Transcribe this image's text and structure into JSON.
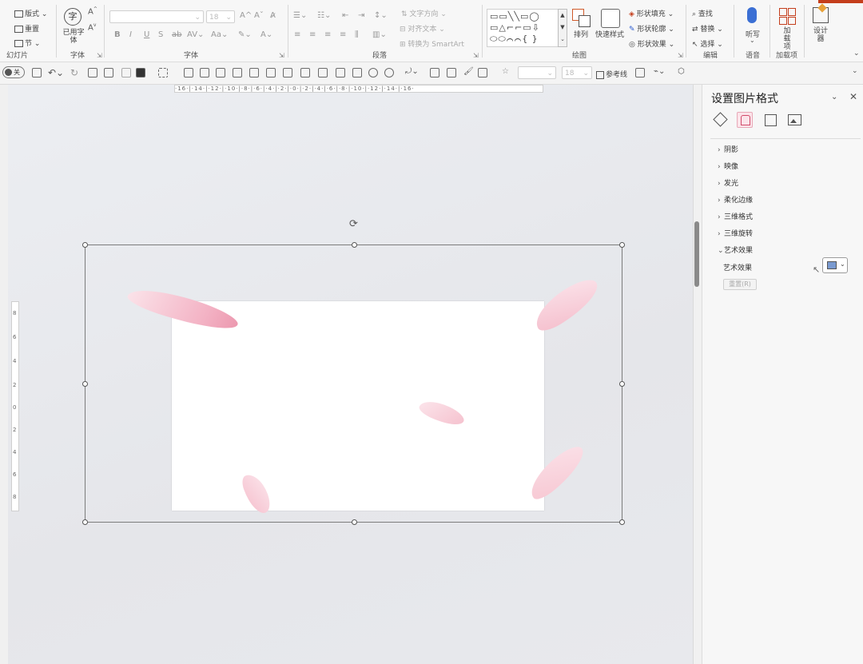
{
  "ribbon": {
    "slides_group": {
      "label": "幻灯片",
      "layout": "版式",
      "reset": "重置",
      "section": "节"
    },
    "font_group": {
      "label": "字体",
      "font_placeholder": "",
      "size_placeholder": "18"
    },
    "used_fonts": {
      "label": "已用字体"
    },
    "paragraph_group": {
      "label": "段落",
      "text_direction": "文字方向",
      "align_text": "对齐文本",
      "convert_smartart": "转换为 SmartArt"
    },
    "drawing_group": {
      "label": "绘图",
      "arrange": "排列",
      "quick_styles": "快速样式",
      "shape_fill": "形状填充",
      "shape_outline": "形状轮廓",
      "shape_effects": "形状效果"
    },
    "editing_group": {
      "label": "编辑",
      "find": "查找",
      "replace": "替换",
      "select": "选择"
    },
    "voice_group": {
      "label": "语音",
      "dictate": "听写"
    },
    "addins_group": {
      "label": "加载项",
      "addins": "加载项"
    },
    "designer": {
      "label": "设计器"
    },
    "font_short": "字体"
  },
  "qat": {
    "toggle_label": "关",
    "size_value": "18",
    "reference_line": "参考线"
  },
  "ruler": {
    "h_text": "·16·|·14·|·12·|·10·|·8·|·6·|·4·|·2·|·0·|·2·|·4·|·6·|·8·|·10·|·12·|·14·|·16·",
    "v_ticks": [
      "8",
      "6",
      "4",
      "2",
      "0",
      "2",
      "4",
      "6",
      "8"
    ]
  },
  "pane": {
    "title": "设置图片格式",
    "sections": [
      {
        "label": "阴影",
        "expanded": false
      },
      {
        "label": "映像",
        "expanded": false
      },
      {
        "label": "发光",
        "expanded": false
      },
      {
        "label": "柔化边缘",
        "expanded": false
      },
      {
        "label": "三维格式",
        "expanded": false
      },
      {
        "label": "三维旋转",
        "expanded": false
      },
      {
        "label": "艺术效果",
        "expanded": true
      }
    ],
    "art_effect_label": "艺术效果",
    "reset_label": "重置(R)"
  },
  "colors": {
    "accent": "#c43e1c",
    "petal": "#f3b7c6",
    "selection": "#7c7c7c"
  }
}
